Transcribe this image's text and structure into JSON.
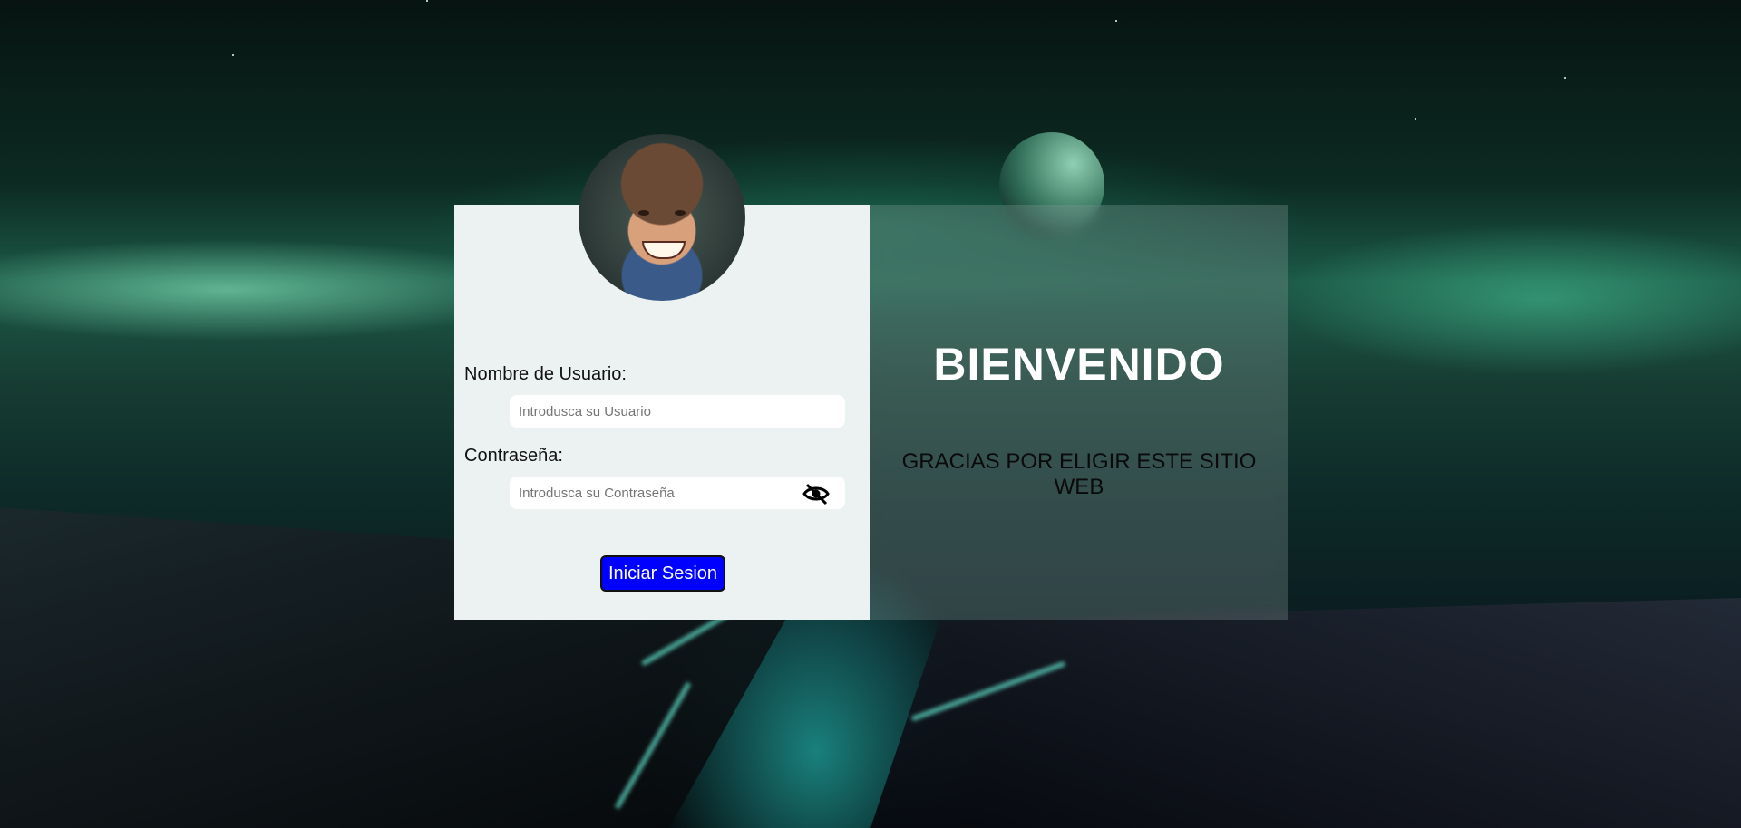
{
  "login": {
    "username_label": "Nombre de Usuario:",
    "username_placeholder": "Introdusca su Usuario",
    "password_label": "Contraseña:",
    "password_placeholder": "Introdusca su Contraseña",
    "toggle_icon": "eye-slash-icon",
    "submit_label": "Iniciar Sesion",
    "submit_color": "#0000ff"
  },
  "welcome": {
    "title": "BIENVENIDO",
    "subtitle": "GRACIAS POR ELIGIR ESTE SITIO WEB"
  },
  "avatar": {
    "icon": "user-avatar"
  }
}
